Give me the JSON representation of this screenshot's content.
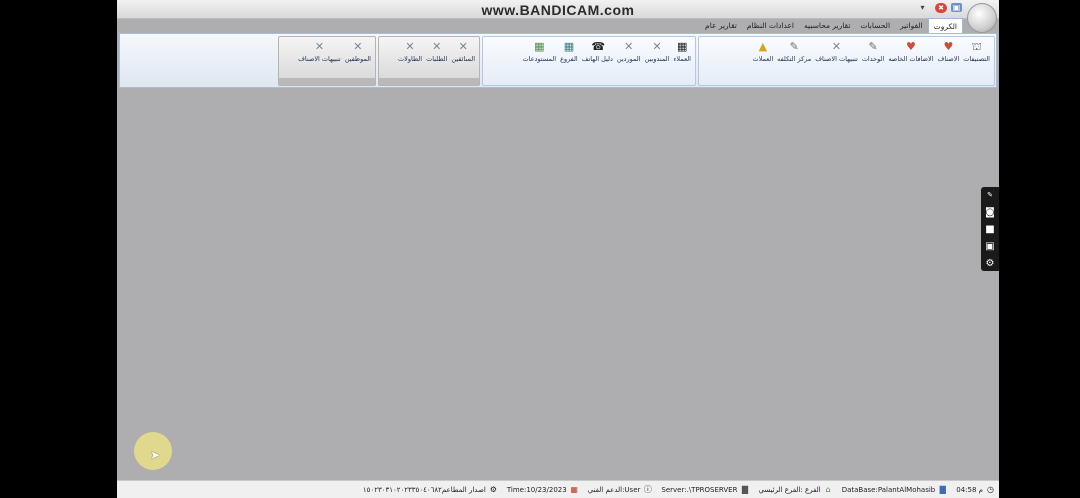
{
  "window": {
    "watermark": "www.BANDICAM.com",
    "minimize_icon": "▾",
    "close_icon": "✖",
    "maximize_icon": "▣"
  },
  "tabs": [
    "الكروت",
    "الفواتير",
    "الحسابات",
    "تقارير محاسبيه",
    "اعدادات النظام",
    "تقارير عام"
  ],
  "active_tab": 0,
  "ribbon": {
    "group1": [
      {
        "label": "التصنيفات",
        "icon": "category-icon"
      },
      {
        "label": "الاصناف",
        "icon": "items-icon"
      },
      {
        "label": "الاضافات الخاصه",
        "icon": "additions-icon"
      },
      {
        "label": "الوحدات",
        "icon": "units-icon"
      },
      {
        "label": "تنبيهات الاصناف",
        "icon": "x-icon"
      },
      {
        "label": "مركز التكلفه",
        "icon": "cost-center-icon"
      },
      {
        "label": "العملات",
        "icon": "currency-icon"
      }
    ],
    "group2": [
      {
        "label": "العملاء",
        "icon": "customers-icon"
      },
      {
        "label": "المندوبين",
        "icon": "x-icon"
      },
      {
        "label": "الموردين",
        "icon": "x-icon"
      },
      {
        "label": "دليل الهاتف",
        "icon": "phone-icon"
      },
      {
        "label": "الفروع",
        "icon": "branches-icon"
      },
      {
        "label": "المستودعات",
        "icon": "warehouses-icon"
      }
    ],
    "group3": [
      {
        "label": "السائقين",
        "icon": "x-icon"
      },
      {
        "label": "الطلبات",
        "icon": "x-icon"
      },
      {
        "label": "الطاولات",
        "icon": "x-icon"
      }
    ],
    "group4": [
      {
        "label": "الموظفين",
        "icon": "x-icon"
      },
      {
        "label": "تنبيهات الاصناف",
        "icon": "x-icon"
      }
    ]
  },
  "statusbar": {
    "time_clock": "04:58 م",
    "database": "DataBase:PalantAlMohasib",
    "branch": "الفرع :الفرع الرئيسي",
    "server": "Server:.\\TPROSERVER",
    "support": "الدعم الفني:User",
    "date": "Time:10/23/2023",
    "version": "اصدار المطاعم١٥٠٢٣٠٣١٠٢٠٢٣٣٥٠٤٠٦٨٢"
  },
  "sidebar_tools": [
    "pen-icon",
    "camera-icon",
    "video-icon",
    "window-icon",
    "gear-icon"
  ]
}
